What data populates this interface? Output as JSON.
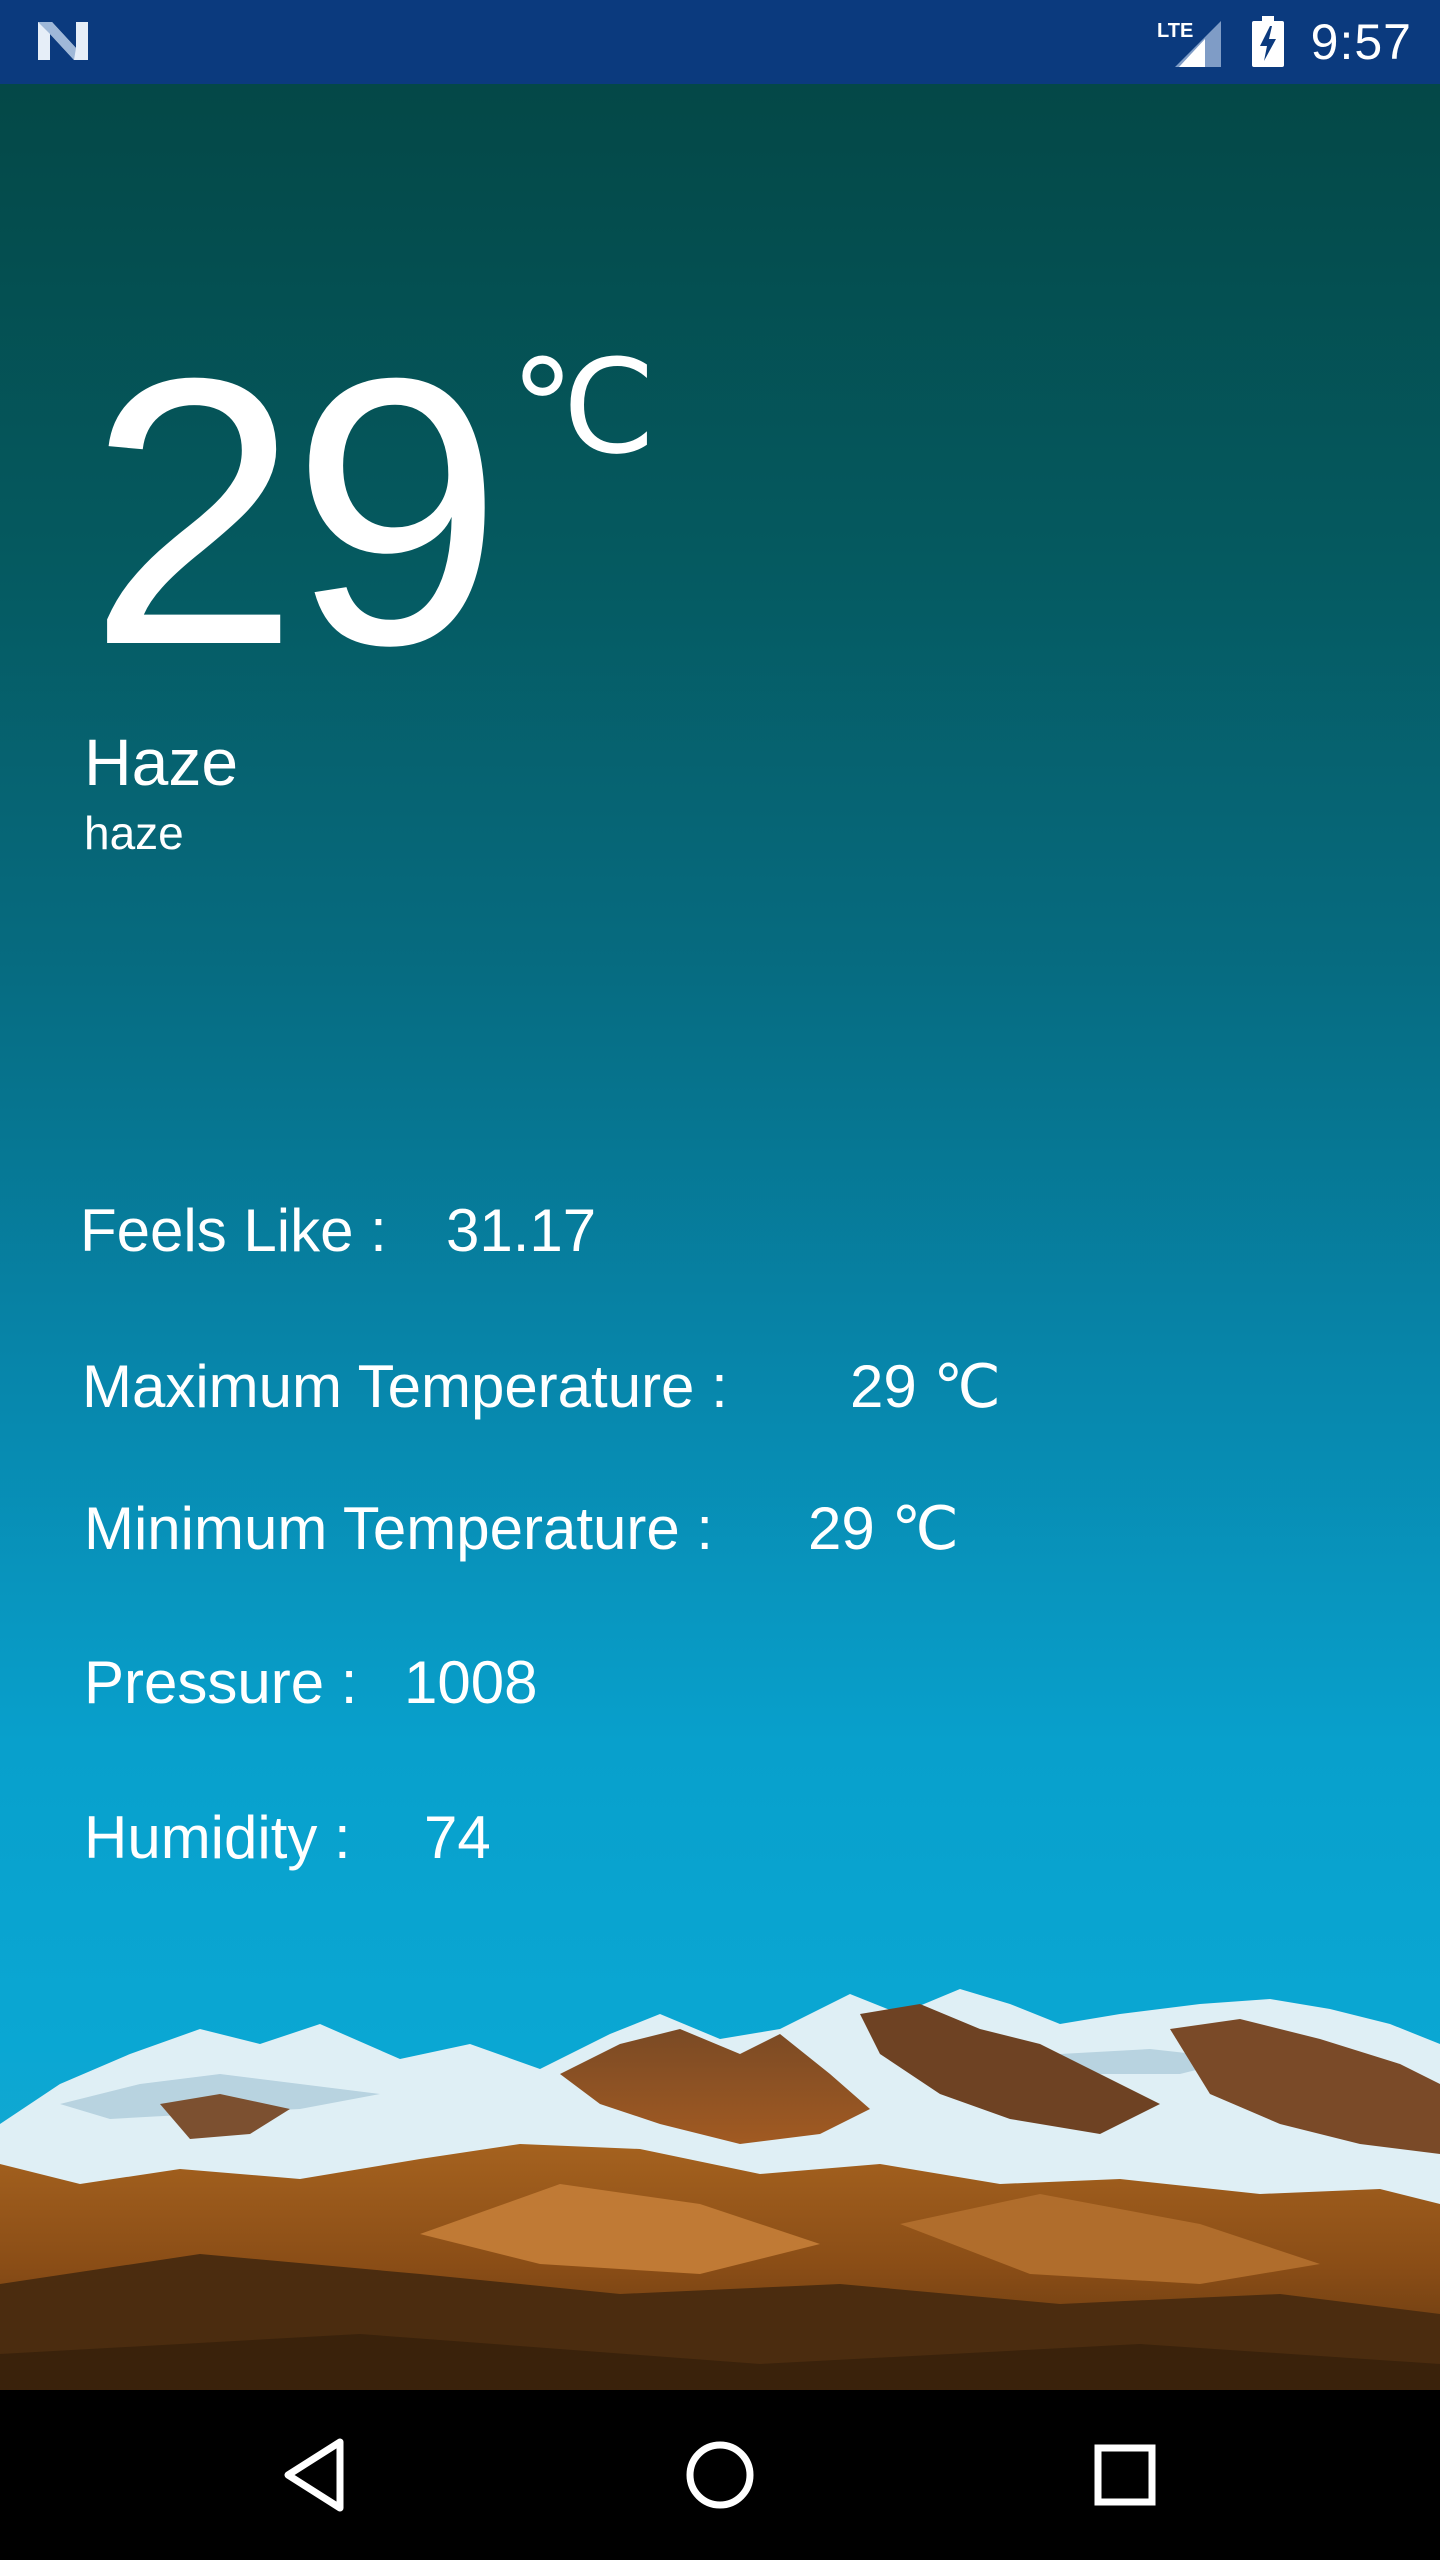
{
  "status_bar": {
    "time": "9:57",
    "network": "LTE"
  },
  "weather": {
    "temperature": "29",
    "temperature_unit": "℃",
    "condition": "Haze",
    "description": "haze"
  },
  "details": {
    "feels_like": {
      "label": "Feels Like :",
      "value": "31.17"
    },
    "max_temp": {
      "label": "Maximum Temperature :",
      "value": "29 ℃"
    },
    "min_temp": {
      "label": "Minimum Temperature :",
      "value": "29 ℃"
    },
    "pressure": {
      "label": "Pressure :",
      "value": "1008"
    },
    "humidity": {
      "label": "Humidity :",
      "value": "74"
    }
  },
  "colors": {
    "status_bar": "#0b3a7e",
    "background_top": "#044847",
    "background_bottom": "#0aa7d3",
    "text": "#ffffff"
  },
  "icons": {
    "status_left": "android-n-icon",
    "signal": "lte-signal-icon",
    "battery": "battery-charging-icon",
    "nav_back": "back-triangle-icon",
    "nav_home": "home-circle-icon",
    "nav_recents": "recents-square-icon"
  }
}
